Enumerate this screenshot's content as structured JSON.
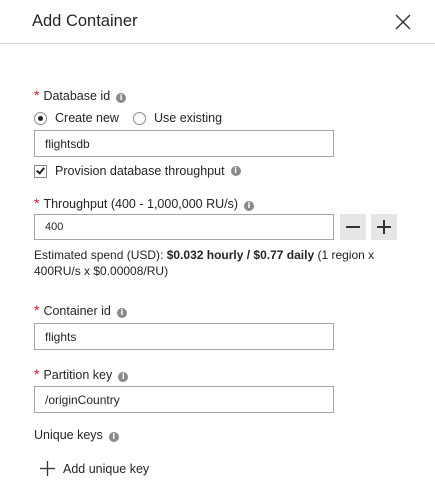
{
  "panel": {
    "title": "Add Container"
  },
  "database": {
    "label": "Database id",
    "required_mark": "*",
    "options": [
      "Create new",
      "Use existing"
    ],
    "selected": "Create new",
    "value": "flightsdb",
    "provision_label": "Provision database throughput",
    "provision_checked": true
  },
  "throughput": {
    "label": "Throughput (400 - 1,000,000 RU/s)",
    "required_mark": "*",
    "value": "400",
    "spend_prefix": "Estimated spend (USD): ",
    "spend_bold": "$0.032 hourly / $0.77 daily",
    "spend_suffix": " (1 region x 400RU/s x $0.00008/RU)"
  },
  "container": {
    "label": "Container id",
    "required_mark": "*",
    "value": "flights"
  },
  "partition": {
    "label": "Partition key",
    "required_mark": "*",
    "value": "/originCountry"
  },
  "unique_keys": {
    "label": "Unique keys",
    "add_label": "Add unique key"
  }
}
